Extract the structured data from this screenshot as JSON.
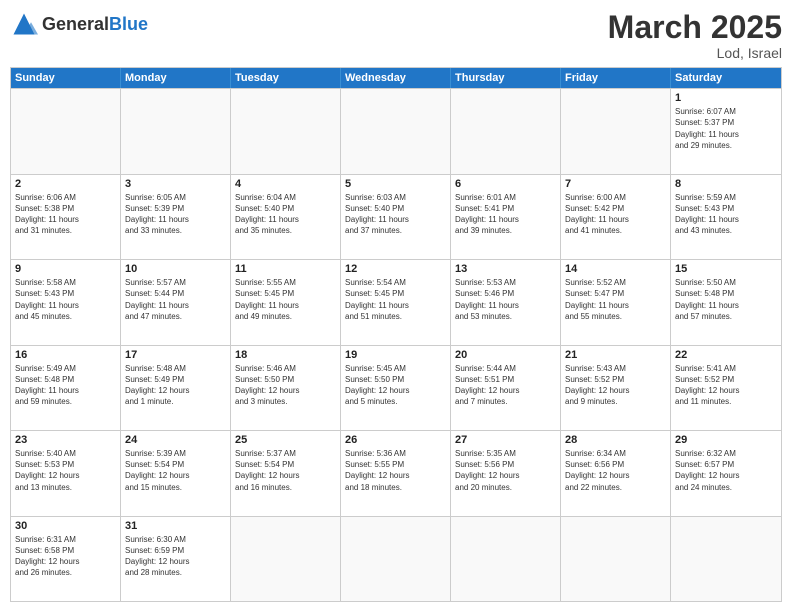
{
  "header": {
    "logo_general": "General",
    "logo_blue": "Blue",
    "month": "March 2025",
    "location": "Lod, Israel"
  },
  "weekdays": [
    "Sunday",
    "Monday",
    "Tuesday",
    "Wednesday",
    "Thursday",
    "Friday",
    "Saturday"
  ],
  "rows": [
    [
      {
        "day": "",
        "empty": true
      },
      {
        "day": "",
        "empty": true
      },
      {
        "day": "",
        "empty": true
      },
      {
        "day": "",
        "empty": true
      },
      {
        "day": "",
        "empty": true
      },
      {
        "day": "",
        "empty": true
      },
      {
        "day": "1",
        "info": "Sunrise: 6:07 AM\nSunset: 5:37 PM\nDaylight: 11 hours\nand 29 minutes."
      }
    ],
    [
      {
        "day": "2",
        "info": "Sunrise: 6:06 AM\nSunset: 5:38 PM\nDaylight: 11 hours\nand 31 minutes."
      },
      {
        "day": "3",
        "info": "Sunrise: 6:05 AM\nSunset: 5:39 PM\nDaylight: 11 hours\nand 33 minutes."
      },
      {
        "day": "4",
        "info": "Sunrise: 6:04 AM\nSunset: 5:40 PM\nDaylight: 11 hours\nand 35 minutes."
      },
      {
        "day": "5",
        "info": "Sunrise: 6:03 AM\nSunset: 5:40 PM\nDaylight: 11 hours\nand 37 minutes."
      },
      {
        "day": "6",
        "info": "Sunrise: 6:01 AM\nSunset: 5:41 PM\nDaylight: 11 hours\nand 39 minutes."
      },
      {
        "day": "7",
        "info": "Sunrise: 6:00 AM\nSunset: 5:42 PM\nDaylight: 11 hours\nand 41 minutes."
      },
      {
        "day": "8",
        "info": "Sunrise: 5:59 AM\nSunset: 5:43 PM\nDaylight: 11 hours\nand 43 minutes."
      }
    ],
    [
      {
        "day": "9",
        "info": "Sunrise: 5:58 AM\nSunset: 5:43 PM\nDaylight: 11 hours\nand 45 minutes."
      },
      {
        "day": "10",
        "info": "Sunrise: 5:57 AM\nSunset: 5:44 PM\nDaylight: 11 hours\nand 47 minutes."
      },
      {
        "day": "11",
        "info": "Sunrise: 5:55 AM\nSunset: 5:45 PM\nDaylight: 11 hours\nand 49 minutes."
      },
      {
        "day": "12",
        "info": "Sunrise: 5:54 AM\nSunset: 5:45 PM\nDaylight: 11 hours\nand 51 minutes."
      },
      {
        "day": "13",
        "info": "Sunrise: 5:53 AM\nSunset: 5:46 PM\nDaylight: 11 hours\nand 53 minutes."
      },
      {
        "day": "14",
        "info": "Sunrise: 5:52 AM\nSunset: 5:47 PM\nDaylight: 11 hours\nand 55 minutes."
      },
      {
        "day": "15",
        "info": "Sunrise: 5:50 AM\nSunset: 5:48 PM\nDaylight: 11 hours\nand 57 minutes."
      }
    ],
    [
      {
        "day": "16",
        "info": "Sunrise: 5:49 AM\nSunset: 5:48 PM\nDaylight: 11 hours\nand 59 minutes."
      },
      {
        "day": "17",
        "info": "Sunrise: 5:48 AM\nSunset: 5:49 PM\nDaylight: 12 hours\nand 1 minute."
      },
      {
        "day": "18",
        "info": "Sunrise: 5:46 AM\nSunset: 5:50 PM\nDaylight: 12 hours\nand 3 minutes."
      },
      {
        "day": "19",
        "info": "Sunrise: 5:45 AM\nSunset: 5:50 PM\nDaylight: 12 hours\nand 5 minutes."
      },
      {
        "day": "20",
        "info": "Sunrise: 5:44 AM\nSunset: 5:51 PM\nDaylight: 12 hours\nand 7 minutes."
      },
      {
        "day": "21",
        "info": "Sunrise: 5:43 AM\nSunset: 5:52 PM\nDaylight: 12 hours\nand 9 minutes."
      },
      {
        "day": "22",
        "info": "Sunrise: 5:41 AM\nSunset: 5:52 PM\nDaylight: 12 hours\nand 11 minutes."
      }
    ],
    [
      {
        "day": "23",
        "info": "Sunrise: 5:40 AM\nSunset: 5:53 PM\nDaylight: 12 hours\nand 13 minutes."
      },
      {
        "day": "24",
        "info": "Sunrise: 5:39 AM\nSunset: 5:54 PM\nDaylight: 12 hours\nand 15 minutes."
      },
      {
        "day": "25",
        "info": "Sunrise: 5:37 AM\nSunset: 5:54 PM\nDaylight: 12 hours\nand 16 minutes."
      },
      {
        "day": "26",
        "info": "Sunrise: 5:36 AM\nSunset: 5:55 PM\nDaylight: 12 hours\nand 18 minutes."
      },
      {
        "day": "27",
        "info": "Sunrise: 5:35 AM\nSunset: 5:56 PM\nDaylight: 12 hours\nand 20 minutes."
      },
      {
        "day": "28",
        "info": "Sunrise: 6:34 AM\nSunset: 6:56 PM\nDaylight: 12 hours\nand 22 minutes."
      },
      {
        "day": "29",
        "info": "Sunrise: 6:32 AM\nSunset: 6:57 PM\nDaylight: 12 hours\nand 24 minutes."
      }
    ],
    [
      {
        "day": "30",
        "info": "Sunrise: 6:31 AM\nSunset: 6:58 PM\nDaylight: 12 hours\nand 26 minutes."
      },
      {
        "day": "31",
        "info": "Sunrise: 6:30 AM\nSunset: 6:59 PM\nDaylight: 12 hours\nand 28 minutes."
      },
      {
        "day": "",
        "empty": true
      },
      {
        "day": "",
        "empty": true
      },
      {
        "day": "",
        "empty": true
      },
      {
        "day": "",
        "empty": true
      },
      {
        "day": "",
        "empty": true
      }
    ]
  ]
}
